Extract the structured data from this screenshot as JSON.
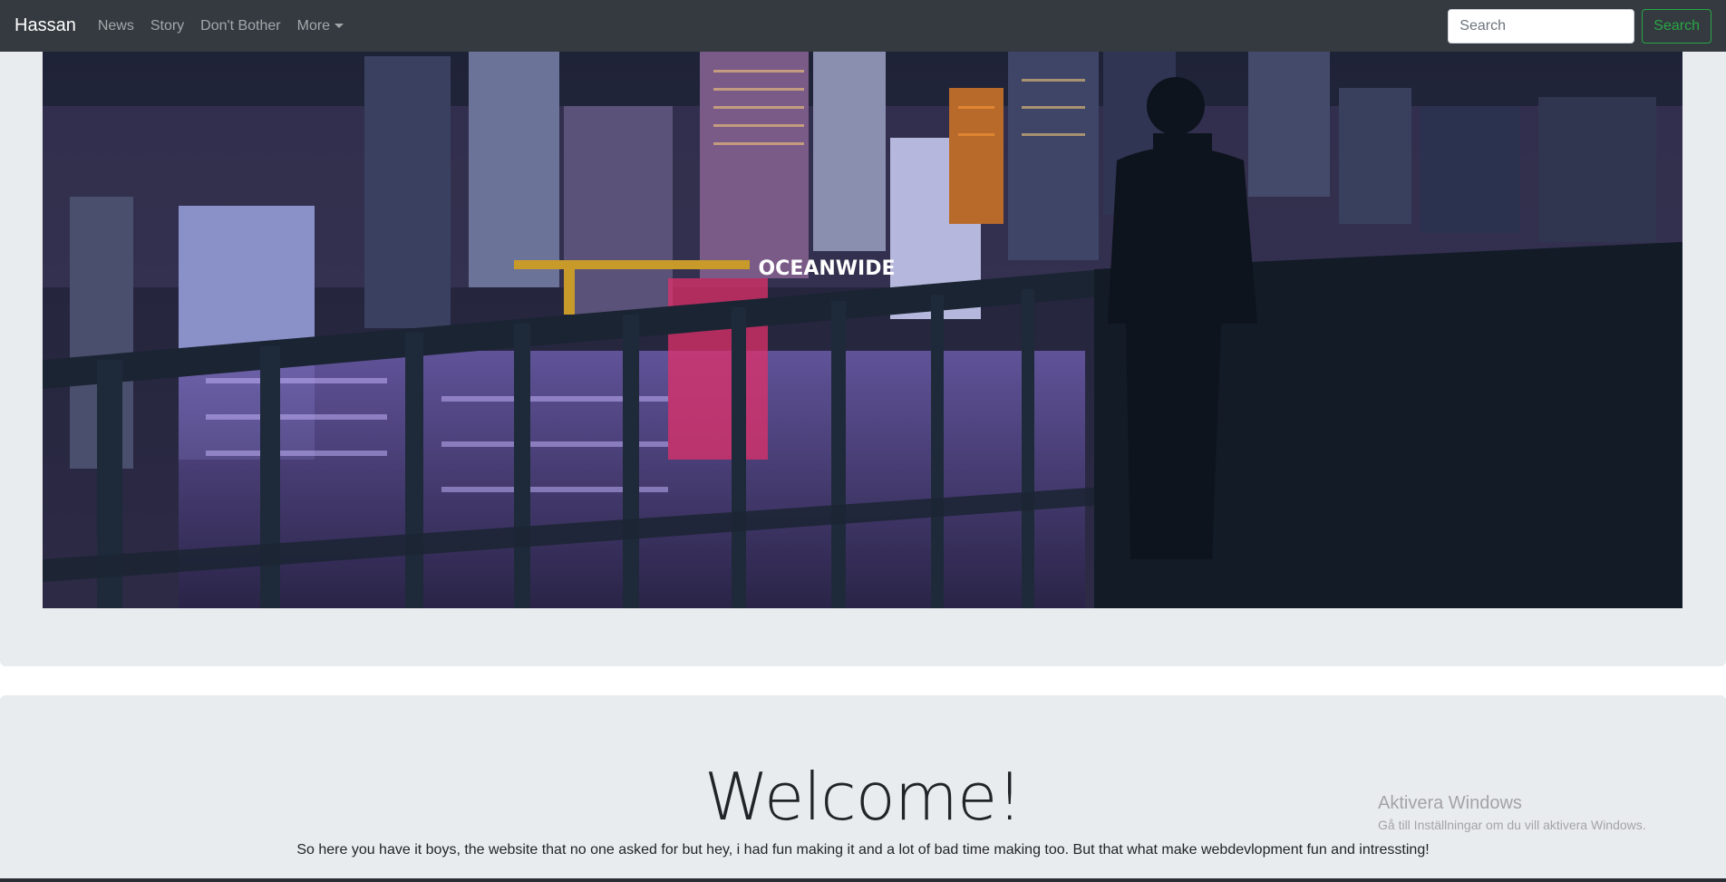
{
  "navbar": {
    "brand": "Hassan",
    "links": [
      {
        "label": "News"
      },
      {
        "label": "Story"
      },
      {
        "label": "Don't Bother"
      },
      {
        "label": "More"
      }
    ],
    "search": {
      "placeholder": "Search",
      "value": "",
      "button_label": "Search"
    },
    "colors": {
      "background": "#343a40",
      "search_accent": "#28a745"
    }
  },
  "hero": {
    "image_sign_text": "OCEANWIDE"
  },
  "welcome": {
    "title": "Welcome!",
    "text": "So here you have it boys, the website that no one asked for but hey, i had fun making it and a lot of bad time making too. But that what make webdevlopment fun and intressting!"
  },
  "watermark": {
    "title": "Aktivera Windows",
    "subtitle": "Gå till Inställningar om du vill aktivera Windows."
  }
}
